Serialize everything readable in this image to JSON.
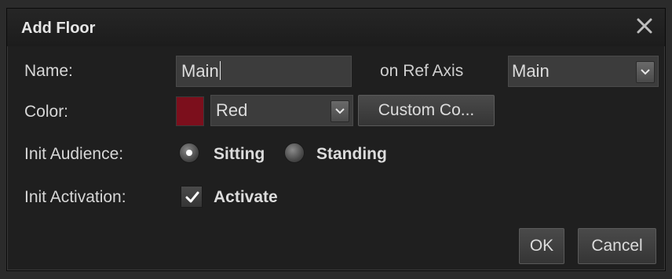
{
  "dialog": {
    "title": "Add Floor",
    "close_icon": "close-icon"
  },
  "name_row": {
    "label": "Name:",
    "value": "Main",
    "ref_axis_label": "on Ref Axis",
    "ref_axis_value": "Main"
  },
  "color_row": {
    "label": "Color:",
    "swatch_color": "#7c0f1c",
    "selected": "Red",
    "custom_button": "Custom Co..."
  },
  "audience_row": {
    "label": "Init Audience:",
    "options": [
      {
        "label": "Sitting",
        "selected": true
      },
      {
        "label": "Standing",
        "selected": false
      }
    ]
  },
  "activation_row": {
    "label": "Init Activation:",
    "checkbox_label": "Activate",
    "checked": true
  },
  "buttons": {
    "ok": "OK",
    "cancel": "Cancel"
  }
}
